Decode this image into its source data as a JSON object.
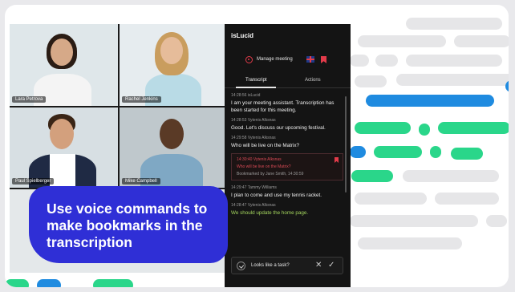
{
  "participants": [
    {
      "name": "Lara Petrova",
      "hair": "#2a1c14",
      "shirt": "#f4f4f4",
      "bg": "#dfe7ea"
    },
    {
      "name": "Rachel Jenkins",
      "hair": "#c99d5e",
      "shirt": "#b9dbe6",
      "bg": "#e6ecef"
    },
    {
      "name": "Paul Spielberger",
      "hair": "#3a2516",
      "shirt": "#ffffff",
      "bg": "#d7dfe3"
    },
    {
      "name": "Mike Campbell",
      "hair": "#111111",
      "shirt": "#7fa8c4",
      "bg": "#bfc8cc"
    }
  ],
  "panel": {
    "app_title": "isLucid",
    "manage_label": "Manage meeting",
    "tabs": [
      "Transcript",
      "Actions"
    ],
    "messages": [
      {
        "meta": "14:28:56  isLucid",
        "text": "I am your meeting assistant. Transcription has been started for this meeting."
      },
      {
        "meta": "14:28:53  Vytenis Alksnas",
        "text": "Good. Let's discuss our upcoming festival."
      },
      {
        "meta": "14:29:58  Vytenis Alksnas",
        "text": "Who will be live on the Matrix?"
      }
    ],
    "bookmark": {
      "line1": "14:30:40  Vytenis Alksnas",
      "line2": "Who will be live on the Matrix?",
      "line3": "Bookmarked by Jane Smith, 14:30:59"
    },
    "messages_after": [
      {
        "meta": "14:29:47  Tammy Williams",
        "text": "I plan to come and use my tennis racket.",
        "green": false
      },
      {
        "meta": "14:28:47  Vytenis Alksnas",
        "text": "We should update the home page.",
        "green": true
      }
    ],
    "task_label": "Looks like a task?"
  },
  "callout": {
    "text": "Use voice commands to make bookmarks in the transcription"
  },
  "colors": {
    "accent_blue": "#2f2fd6",
    "accent_green": "#2ad68a",
    "dash_blue": "#1f8be0",
    "dash_gray": "#e6e6e8",
    "record_red": "#e23b4a"
  }
}
